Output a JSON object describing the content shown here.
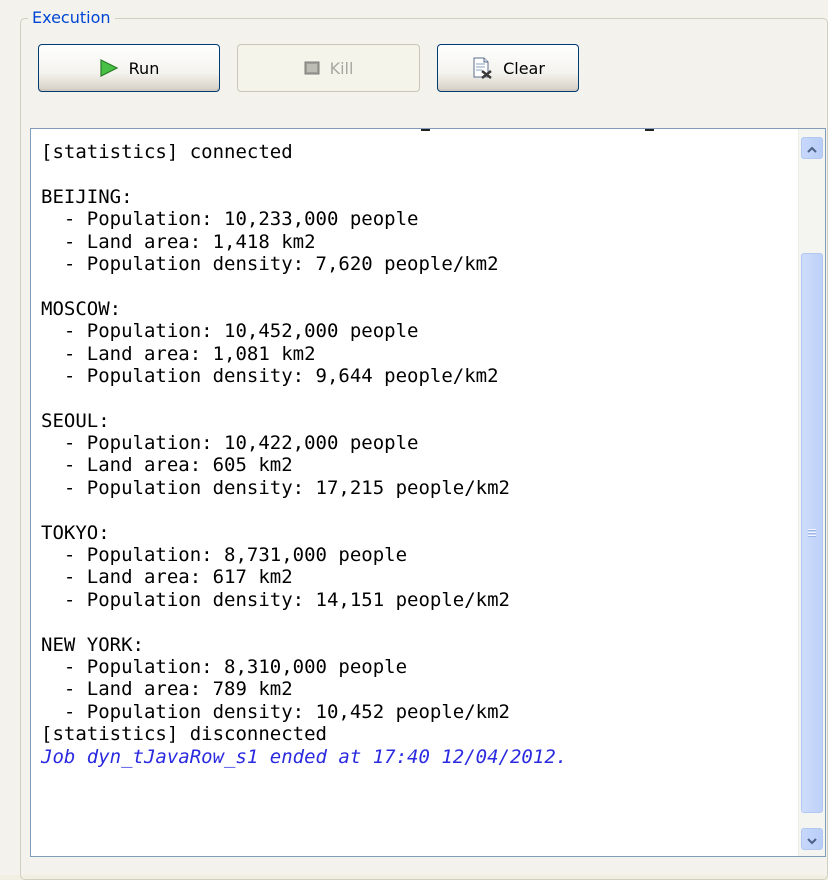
{
  "execution": {
    "group_title": "Execution",
    "run_label": "Run",
    "kill_label": "Kill",
    "clear_label": "Clear"
  },
  "icons": {
    "run": "play-icon",
    "kill": "stop-icon",
    "clear": "clear-document-icon"
  },
  "colors": {
    "group_title": "#0046d5",
    "job_ended_text": "#2a2ae0",
    "run_icon": "#3cae3a"
  },
  "console": {
    "lines": [
      "[statistics] connected",
      "",
      "BEIJING:",
      "  - Population: 10,233,000 people",
      "  - Land area: 1,418 km2",
      "  - Population density: 7,620 people/km2",
      "",
      "MOSCOW:",
      "  - Population: 10,452,000 people",
      "  - Land area: 1,081 km2",
      "  - Population density: 9,644 people/km2",
      "",
      "SEOUL:",
      "  - Population: 10,422,000 people",
      "  - Land area: 605 km2",
      "  - Population density: 17,215 people/km2",
      "",
      "TOKYO:",
      "  - Population: 8,731,000 people",
      "  - Land area: 617 km2",
      "  - Population density: 14,151 people/km2",
      "",
      "NEW YORK:",
      "  - Population: 8,310,000 people",
      "  - Land area: 789 km2",
      "  - Population density: 10,452 people/km2",
      "[statistics] disconnected"
    ],
    "job_ended": "Job dyn_tJavaRow_s1 ended at 17:40 12/04/2012."
  }
}
